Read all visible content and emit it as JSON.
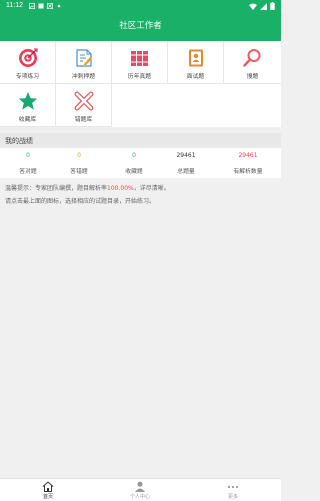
{
  "status_bar": {
    "time": "11:12"
  },
  "app_bar": {
    "title": "社区工作者"
  },
  "grid": [
    {
      "label": "专项练习",
      "icon": "target-icon"
    },
    {
      "label": "冲刺押题",
      "icon": "edit-document-icon"
    },
    {
      "label": "历年真题",
      "icon": "books-icon"
    },
    {
      "label": "面试题",
      "icon": "contacts-book-icon"
    },
    {
      "label": "搜题",
      "icon": "search-icon"
    },
    {
      "label": "收藏库",
      "icon": "star-icon"
    },
    {
      "label": "错题库",
      "icon": "wrong-x-icon"
    }
  ],
  "section": {
    "title": "我的战绩"
  },
  "stats": [
    {
      "value": "0",
      "label": "答对题",
      "color": "#3a9ad9"
    },
    {
      "value": "0",
      "label": "答错题",
      "color": "#f0a020"
    },
    {
      "value": "0",
      "label": "收藏题",
      "color": "#3a9ad9"
    },
    {
      "value": "29461",
      "label": "总题量",
      "color": "#333333"
    },
    {
      "value": "29461",
      "label": "有解析数量",
      "color": "#f04848"
    }
  ],
  "tips": {
    "line1_prefix": "温馨提示：专家团队编撰，题目解析率",
    "line1_rate": "100.00%",
    "line1_suffix": "，详尽清晰。",
    "line2": "请点击最上面的图标，选择相应的试题目录，开始练习。"
  },
  "tabs": [
    {
      "label": "首页",
      "icon": "home-icon"
    },
    {
      "label": "个人中心",
      "icon": "person-icon"
    },
    {
      "label": "更多",
      "icon": "more-dots-icon"
    }
  ],
  "colors": {
    "brand": "#1ab067",
    "accent_red": "#f04848"
  }
}
